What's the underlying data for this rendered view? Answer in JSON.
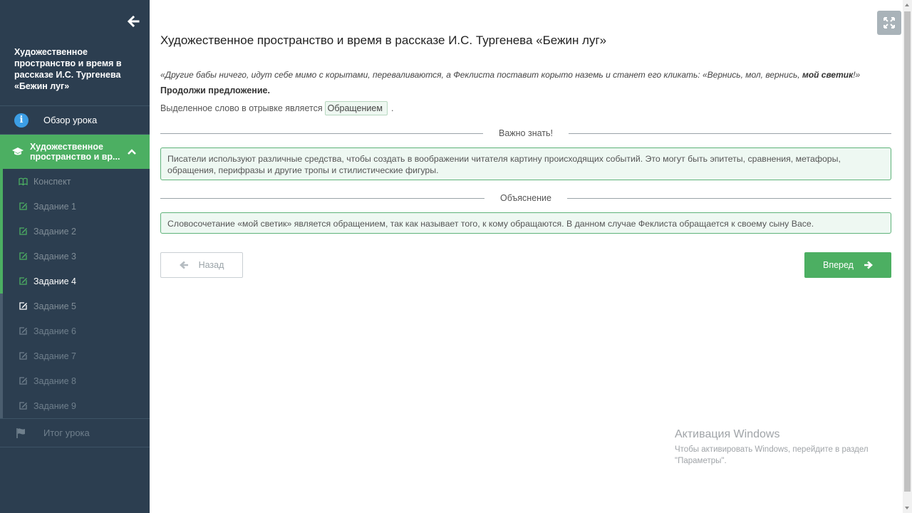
{
  "sidebar": {
    "title": "Художественное пространство и время в рассказе И.С. Тургенева «Бежин луг»",
    "overview": {
      "label": "Обзор урока",
      "icon": "info-icon"
    },
    "active_section": {
      "label": "Художественное пространство и вр...",
      "icon": "graduation-cap-icon"
    },
    "items": [
      {
        "label": "Конспект",
        "icon": "book-icon",
        "state": "done"
      },
      {
        "label": "Задание 1",
        "icon": "edit-icon",
        "state": "done"
      },
      {
        "label": "Задание 2",
        "icon": "edit-icon",
        "state": "done"
      },
      {
        "label": "Задание 3",
        "icon": "edit-icon",
        "state": "done"
      },
      {
        "label": "Задание 4",
        "icon": "edit-icon",
        "state": "current"
      },
      {
        "label": "Задание 5",
        "icon": "edit-icon",
        "state": "pending"
      },
      {
        "label": "Задание 6",
        "icon": "edit-icon",
        "state": "locked"
      },
      {
        "label": "Задание 7",
        "icon": "edit-icon",
        "state": "locked"
      },
      {
        "label": "Задание 8",
        "icon": "edit-icon",
        "state": "locked"
      },
      {
        "label": "Задание 9",
        "icon": "edit-icon",
        "state": "locked"
      }
    ],
    "result": {
      "label": "Итог урока",
      "icon": "flag-icon"
    }
  },
  "main": {
    "title": "Художественное пространство и время в рассказе И.С. Тургенева «Бежин луг»",
    "quote_start": "«Другие бабы ничего, идут себе мимо с корытами, переваливаются, а Феклиста поставит корыто наземь и станет его кликать: «Вернись, мол, вернись, ",
    "quote_bold": "мой светик",
    "quote_end": "!»",
    "instruction": "Продолжи предложение.",
    "answer_prefix": "Выделенное слово в отрывке является",
    "answer_value": "Обращением",
    "answer_suffix": ".",
    "important_label": "Важно знать!",
    "important_text": "Писатели используют различные средства, чтобы создать в воображении читателя картину происходящих событий. Это могут быть эпитеты, сравнения, метафоры, обращения, перифразы и другие тропы и стилистические фигуры.",
    "explanation_label": "Объяснение",
    "explanation_text": "Словосочетание «мой светик» является обращением, так как называет того, к кому обращаются. В данном случае Феклиста обращается к своему сыну Васе.",
    "back_label": "Назад",
    "next_label": "Вперед"
  },
  "watermark": {
    "title": "Активация Windows",
    "text": "Чтобы активировать Windows, перейдите в раздел \"Параметры\"."
  },
  "colors": {
    "sidebar_bg": "#2c3e50",
    "accent_green": "#4caf62",
    "info_blue": "#3c9ee5"
  }
}
